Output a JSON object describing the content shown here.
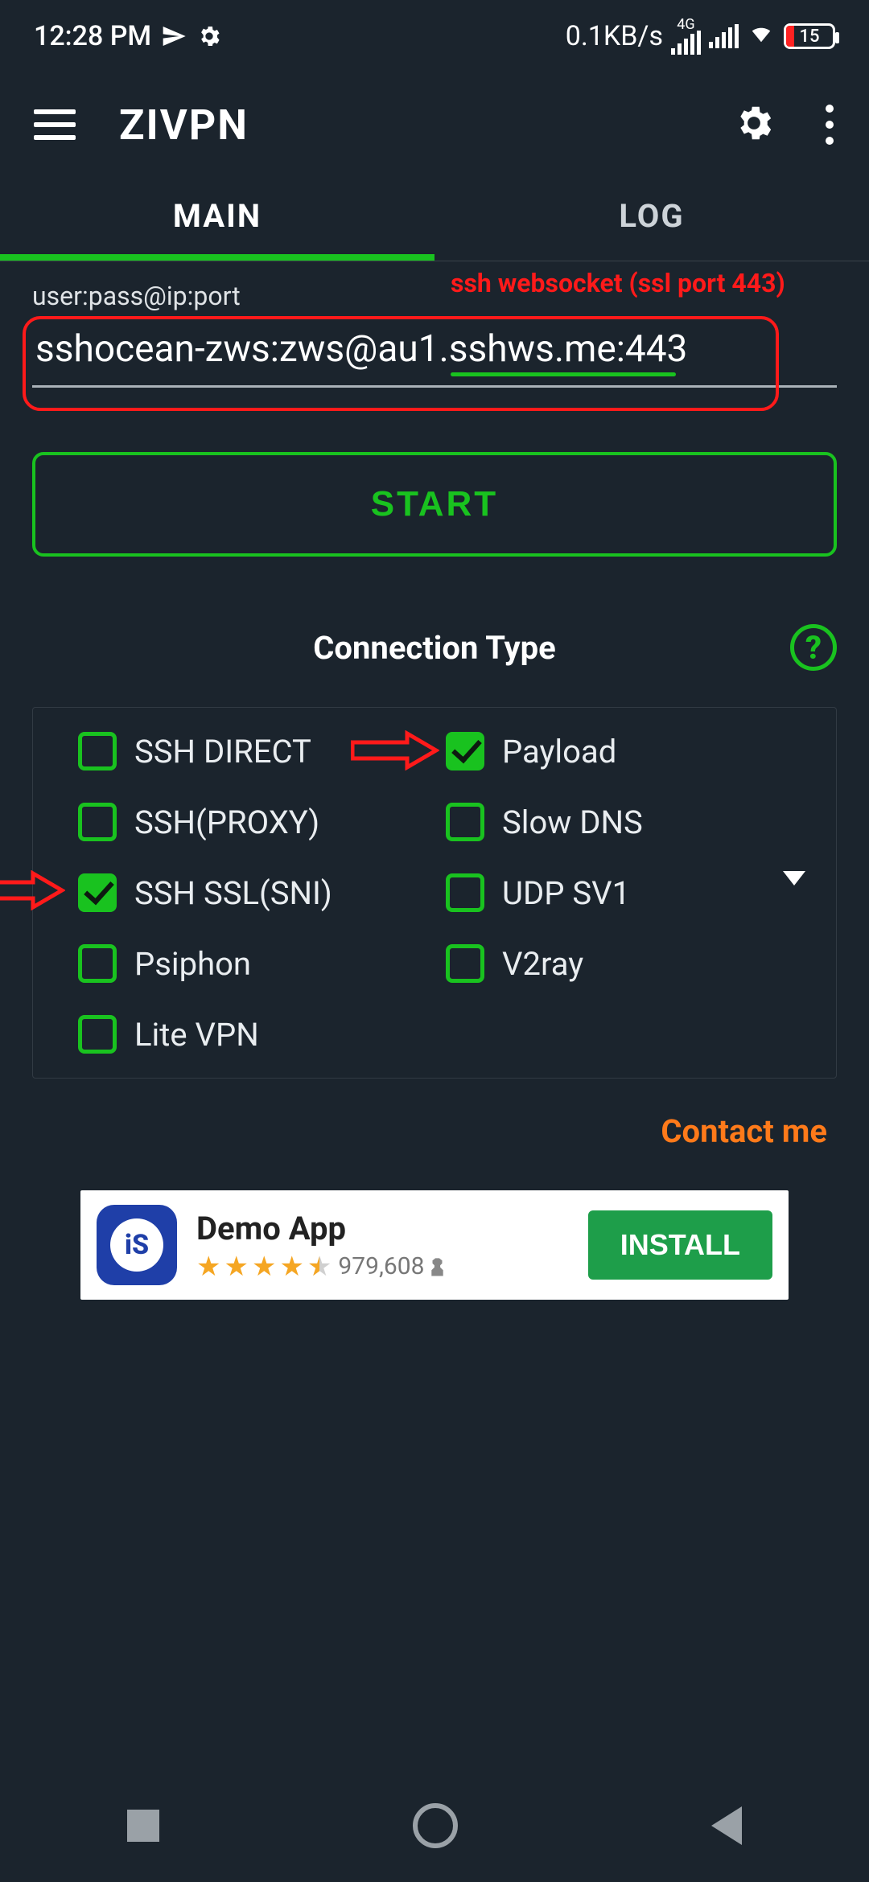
{
  "status_bar": {
    "time": "12:28 PM",
    "net_speed": "0.1KB/s",
    "net_label": "4G",
    "battery_percent": "15"
  },
  "app": {
    "title": "ZIVPN"
  },
  "tabs": {
    "main": "MAIN",
    "log": "LOG"
  },
  "annotations": {
    "banner": "ssh websocket (ssl port 443)"
  },
  "connection_field": {
    "label": "user:pass@ip:port",
    "value": "sshocean-zws:zws@au1.sshws.me:443"
  },
  "start_button": "START",
  "section": {
    "title": "Connection Type",
    "help": "?"
  },
  "options": {
    "ssh_direct": {
      "label": "SSH DIRECT",
      "checked": false
    },
    "ssh_proxy": {
      "label": "SSH(PROXY)",
      "checked": false
    },
    "ssh_ssl_sni": {
      "label": "SSH SSL(SNI)",
      "checked": true
    },
    "psiphon": {
      "label": "Psiphon",
      "checked": false
    },
    "lite_vpn": {
      "label": "Lite VPN",
      "checked": false
    },
    "payload": {
      "label": "Payload",
      "checked": true
    },
    "slow_dns": {
      "label": "Slow DNS",
      "checked": false
    },
    "udp": {
      "label": "UDP SV1",
      "checked": false
    },
    "v2ray": {
      "label": "V2ray",
      "checked": false
    }
  },
  "contact": "Contact me",
  "ad": {
    "title": "Demo App",
    "reviews": "979,608",
    "install": "INSTALL"
  }
}
